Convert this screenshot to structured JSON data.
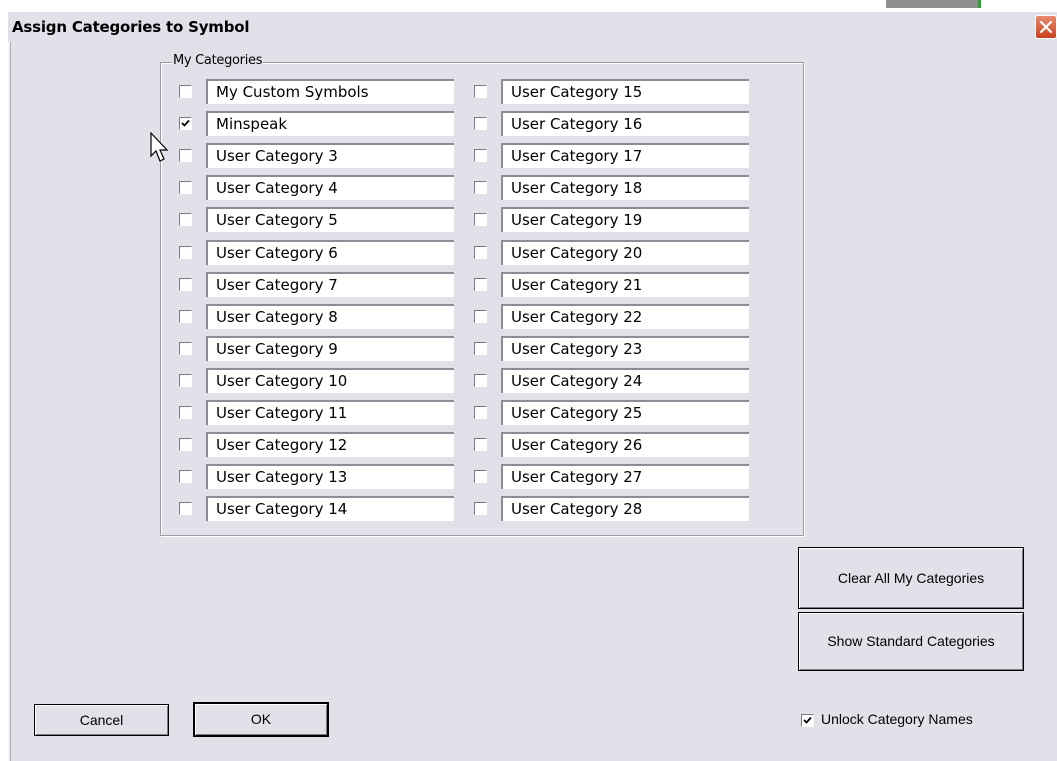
{
  "dialog": {
    "title": "Assign Categories to Symbol"
  },
  "group": {
    "label": "My Categories"
  },
  "categories_left": [
    {
      "name": "My Custom Symbols",
      "checked": false
    },
    {
      "name": "Minspeak",
      "checked": true
    },
    {
      "name": "User Category 3",
      "checked": false
    },
    {
      "name": "User Category 4",
      "checked": false
    },
    {
      "name": "User Category 5",
      "checked": false
    },
    {
      "name": "User Category 6",
      "checked": false
    },
    {
      "name": "User Category 7",
      "checked": false
    },
    {
      "name": "User Category 8",
      "checked": false
    },
    {
      "name": "User Category 9",
      "checked": false
    },
    {
      "name": "User Category 10",
      "checked": false
    },
    {
      "name": "User Category 11",
      "checked": false
    },
    {
      "name": "User Category 12",
      "checked": false
    },
    {
      "name": "User Category 13",
      "checked": false
    },
    {
      "name": "User Category 14",
      "checked": false
    }
  ],
  "categories_right": [
    {
      "name": "User Category 15",
      "checked": false
    },
    {
      "name": "User Category 16",
      "checked": false
    },
    {
      "name": "User Category 17",
      "checked": false
    },
    {
      "name": "User Category 18",
      "checked": false
    },
    {
      "name": "User Category 19",
      "checked": false
    },
    {
      "name": "User Category 20",
      "checked": false
    },
    {
      "name": "User Category 21",
      "checked": false
    },
    {
      "name": "User Category 22",
      "checked": false
    },
    {
      "name": "User Category 23",
      "checked": false
    },
    {
      "name": "User Category 24",
      "checked": false
    },
    {
      "name": "User Category 25",
      "checked": false
    },
    {
      "name": "User Category 26",
      "checked": false
    },
    {
      "name": "User Category 27",
      "checked": false
    },
    {
      "name": "User Category 28",
      "checked": false
    }
  ],
  "buttons": {
    "clear_all": "Clear All My Categories",
    "show_standard": "Show Standard Categories",
    "cancel": "Cancel",
    "ok": "OK"
  },
  "unlock": {
    "label": "Unlock Category Names",
    "checked": true
  },
  "colors": {
    "dialog_bg": "#e1e1e9",
    "close_button": "#c9401e"
  }
}
